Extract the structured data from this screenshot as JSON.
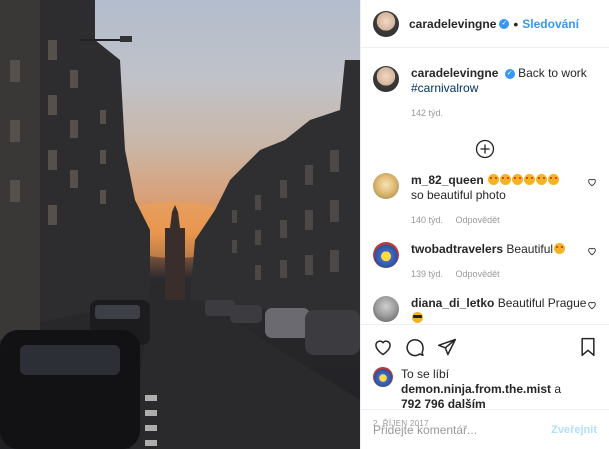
{
  "photo": {
    "alt": "Street at sunset with Powder Tower"
  },
  "header": {
    "username": "caradelevingne",
    "verified_icon": "verified-icon",
    "separator": "•",
    "follow_label": "Sledování",
    "more_label": "•••"
  },
  "caption": {
    "username": "caradelevingne",
    "text": "Back to work",
    "hashtag": "#carnivalrow",
    "age": "142 týd."
  },
  "load_more_icon": "plus-circle-icon",
  "comments": [
    {
      "username": "m_82_queen",
      "text": "so beautiful photo",
      "emoji_count": 6,
      "age": "140 týd.",
      "reply_label": "Odpovědět"
    },
    {
      "username": "twobadtravelers",
      "text": "Beautiful",
      "emoji_count": 1,
      "age": "139 týd.",
      "reply_label": "Odpovědět"
    },
    {
      "username": "diana_di_letko",
      "text": "Beautiful Prague",
      "emoji_count": 1,
      "age": "",
      "reply_label": ""
    }
  ],
  "likes": {
    "prefix": "To se líbí",
    "user": "demon.ninja.from.the.mist",
    "conj": "a",
    "count": "792 796 dalším"
  },
  "date": "2. ŘÍJEN 2017",
  "add_comment": {
    "placeholder": "Přidejte komentář...",
    "post_label": "Zveřejnit"
  },
  "colors": {
    "accent": "#3897f0",
    "post_disabled": "#b2dffc",
    "meta": "#999999",
    "hashtag": "#003569"
  }
}
